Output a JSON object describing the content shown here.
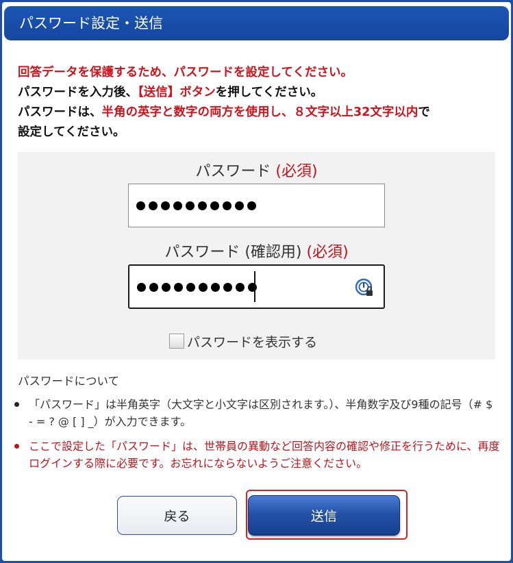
{
  "dialog": {
    "title": "パスワード設定・送信"
  },
  "instructions": {
    "line1": "回答データを保護するため、パスワードを設定してください。",
    "line2_a": "パスワードを入力後、",
    "line2_b": "【送信】ボタン",
    "line2_c": "を押してください。",
    "line3_a": "パスワードは、",
    "line3_b": "半角の英字と数字の両方を使用し、８文字以上32文字以内",
    "line3_c": "で",
    "line4": "設定してください。"
  },
  "form": {
    "password": {
      "label": "パスワード ",
      "required": "(必須)",
      "masked_length": 10
    },
    "confirm": {
      "label": "パスワード (確認用) ",
      "required": "(必須)",
      "masked_length": 10
    },
    "show_password": {
      "label": "パスワードを表示する",
      "checked": false
    }
  },
  "notes": {
    "title": "パスワードについて",
    "items": [
      {
        "text": "「パスワード」は半角英字（大文字と小文字は区別されます。）、半角数字及び9種の記号（# $ - = ? @ [ ] _）が入力できます。",
        "style": "normal"
      },
      {
        "text": "ここで設定した「パスワード」は、世帯員の異動など回答内容の確認や修正を行うために、再度ログインする際に必要です。お忘れにならないようご注意ください。",
        "style": "alert"
      }
    ]
  },
  "buttons": {
    "back": "戻る",
    "submit": "送信"
  },
  "colors": {
    "brand_blue": "#1f4fa6",
    "alert_red": "#d0121b",
    "panel_bg": "#f2f2f2"
  },
  "icons": {
    "password_manager": "password-manager-icon"
  }
}
